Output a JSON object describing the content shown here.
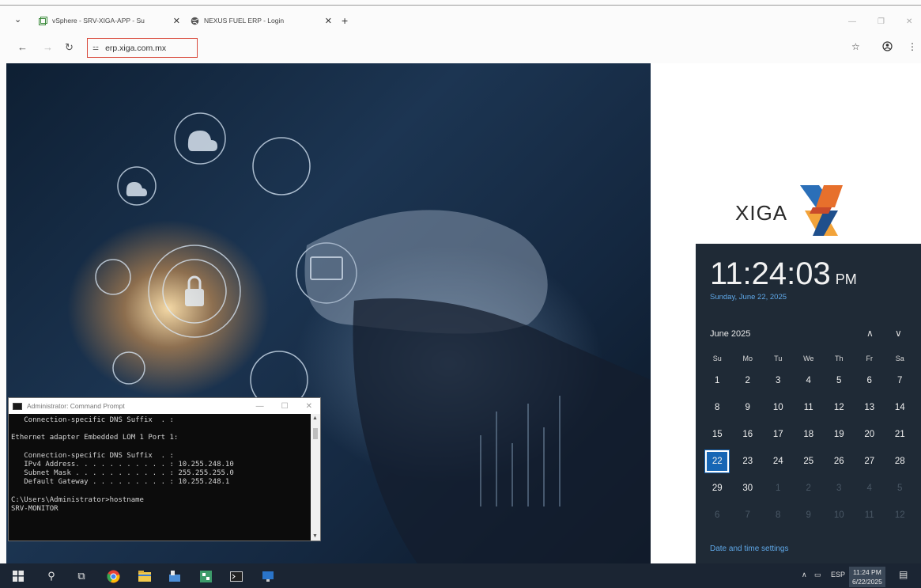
{
  "browser": {
    "tabs": [
      {
        "label": "vSphere - SRV-XIGA-APP - Su",
        "icon": "vsphere-icon"
      },
      {
        "label": "NEXUS FUEL ERP - Login",
        "icon": "globe-icon"
      }
    ],
    "address": "erp.xiga.com.mx"
  },
  "page": {
    "logo_text": "XIGA"
  },
  "clock_flyout": {
    "time": "11:24:03",
    "ampm": "PM",
    "date_long": "Sunday, June 22, 2025",
    "month_label": "June 2025",
    "weekdays": [
      "Su",
      "Mo",
      "Tu",
      "We",
      "Th",
      "Fr",
      "Sa"
    ],
    "weeks": [
      [
        "1",
        "2",
        "3",
        "4",
        "5",
        "6",
        "7"
      ],
      [
        "8",
        "9",
        "10",
        "11",
        "12",
        "13",
        "14"
      ],
      [
        "15",
        "16",
        "17",
        "18",
        "19",
        "20",
        "21"
      ],
      [
        "22",
        "23",
        "24",
        "25",
        "26",
        "27",
        "28"
      ],
      [
        "29",
        "30",
        "1",
        "2",
        "3",
        "4",
        "5"
      ],
      [
        "6",
        "7",
        "8",
        "9",
        "10",
        "11",
        "12"
      ]
    ],
    "today": "22",
    "settings_link": "Date and time settings"
  },
  "cmd": {
    "title": "Administrator: Command Prompt",
    "lines": [
      "   Connection-specific DNS Suffix  . :",
      "",
      "Ethernet adapter Embedded LOM 1 Port 1:",
      "",
      "   Connection-specific DNS Suffix  . :",
      "   IPv4 Address. . . . . . . . . . . : 10.255.248.10",
      "   Subnet Mask . . . . . . . . . . . : 255.255.255.0",
      "   Default Gateway . . . . . . . . . : 10.255.248.1",
      "",
      "C:\\Users\\Administrator>hostname",
      "SRV-MONITOR"
    ]
  },
  "taskbar": {
    "lang": "ESP",
    "time": "11:24 PM",
    "date": "6/22/2025"
  },
  "colors": {
    "accent": "#1766b5",
    "link": "#5fa8e8",
    "flyout_bg": "#1f2a36",
    "taskbar_bg": "#1b2533",
    "address_highlight": "#d94a3c"
  }
}
